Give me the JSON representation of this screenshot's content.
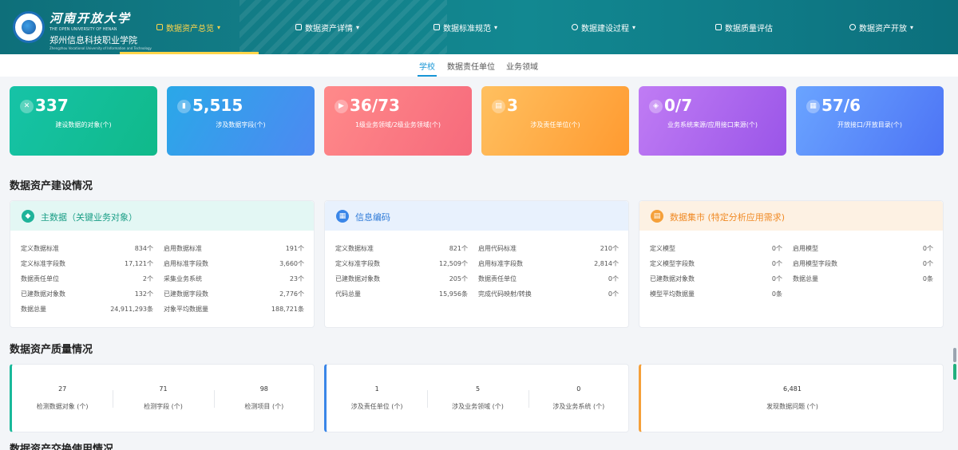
{
  "header": {
    "brand_cn": "河南开放大学",
    "brand_en": "THE OPEN UNIVERSITY OF HENAN",
    "brand_cn2": "郑州信息科技职业学院",
    "brand_en2": "Zhengzhou Vocational University of Information and Technology",
    "nav": [
      {
        "label": "数据资产总览",
        "caret": "▾"
      },
      {
        "label": "数据资产详情",
        "caret": "▾"
      },
      {
        "label": "数据标准规范",
        "caret": "▾"
      },
      {
        "label": "数据建设过程",
        "caret": "▾"
      },
      {
        "label": "数据质量评估",
        "caret": ""
      },
      {
        "label": "数据资产开放",
        "caret": "▾"
      }
    ]
  },
  "subtabs": [
    "学校",
    "数据责任单位",
    "业务领域"
  ],
  "stats": [
    {
      "value": "337",
      "label": "建设数据的对象(个)",
      "icon": "wrench-icon",
      "glyph": "✕",
      "color_from": "#16c3a7",
      "color_to": "#10b98a"
    },
    {
      "value": "5,515",
      "label": "涉及数据字段(个)",
      "icon": "bar-chart-icon",
      "glyph": "▮",
      "color_from": "#2aa8e8",
      "color_to": "#4d89f2"
    },
    {
      "value": "36/73",
      "label": "1级业务领域/2级业务领域(个)",
      "icon": "play-icon",
      "glyph": "▶",
      "color_from": "#ff8a8a",
      "color_to": "#f66a7c"
    },
    {
      "value": "3",
      "label": "涉及责任单位(个)",
      "icon": "document-icon",
      "glyph": "▤",
      "color_from": "#ffc060",
      "color_to": "#ff9a30"
    },
    {
      "value": "0/7",
      "label": "业务系统来源/应用接口来源(个)",
      "icon": "settings-icon",
      "glyph": "◈",
      "color_from": "#c07cf4",
      "color_to": "#9a55e8"
    },
    {
      "value": "57/6",
      "label": "开放接口/开放目录(个)",
      "icon": "grid-icon",
      "glyph": "▦",
      "color_from": "#6aa4ff",
      "color_to": "#4d74f5"
    }
  ],
  "sections": {
    "build": "数据资产建设情况",
    "quality": "数据资产质量情况",
    "next": "数据资产交换使用情况"
  },
  "panels": [
    {
      "title": "主数据（关键业务对象）",
      "icon": "cube-icon",
      "glyph": "◆",
      "head_bg": "#e3f7f4",
      "title_color": "#1a9e86",
      "icon_bg": "#1fb39a",
      "rows": [
        {
          "k1": "定义数据标准",
          "v1": "834个",
          "k2": "启用数据标准",
          "v2": "191个"
        },
        {
          "k1": "定义标准字段数",
          "v1": "17,121个",
          "k2": "启用标准字段数",
          "v2": "3,660个"
        },
        {
          "k1": "数据责任单位",
          "v1": "2个",
          "k2": "采集业务系统",
          "v2": "23个"
        },
        {
          "k1": "已建数据对象数",
          "v1": "132个",
          "k2": "已建数据字段数",
          "v2": "2,776个"
        },
        {
          "k1": "数据总量",
          "v1": "24,911,293条",
          "k2": "对象平均数据量",
          "v2": "188,721条"
        }
      ]
    },
    {
      "title": "信息编码",
      "icon": "calendar-icon",
      "glyph": "▦",
      "head_bg": "#e8f1fd",
      "title_color": "#2f7bd8",
      "icon_bg": "#3a86e8",
      "rows": [
        {
          "k1": "定义数据标准",
          "v1": "821个",
          "k2": "启用代码标准",
          "v2": "210个"
        },
        {
          "k1": "定义标准字段数",
          "v1": "12,509个",
          "k2": "启用标准字段数",
          "v2": "2,814个"
        },
        {
          "k1": "已建数据对象数",
          "v1": "205个",
          "k2": "数据责任单位",
          "v2": "0个"
        },
        {
          "k1": "代码总量",
          "v1": "15,956条",
          "k2": "完成代码映射/转换",
          "v2": "0个"
        }
      ]
    },
    {
      "title": "数据集市 (特定分析应用需求)",
      "icon": "database-icon",
      "glyph": "▤",
      "head_bg": "#fdf1e3",
      "title_color": "#f08a25",
      "icon_bg": "#f5a03a",
      "rows": [
        {
          "k1": "定义模型",
          "v1": "0个",
          "k2": "启用模型",
          "v2": "0个"
        },
        {
          "k1": "定义模型字段数",
          "v1": "0个",
          "k2": "启用模型字段数",
          "v2": "0个"
        },
        {
          "k1": "已建数据对象数",
          "v1": "0个",
          "k2": "数据总量",
          "v2": "0条"
        },
        {
          "k1": "模型平均数据量",
          "v1": "0条",
          "k2": "",
          "v2": ""
        }
      ]
    }
  ],
  "quality_panels": [
    {
      "accent": "#19b99a",
      "items": [
        {
          "value": "27",
          "label": "检测数据对象 (个)"
        },
        {
          "value": "71",
          "label": "检测字段 (个)"
        },
        {
          "value": "98",
          "label": "检测项目 (个)"
        }
      ]
    },
    {
      "accent": "#3a86e8",
      "items": [
        {
          "value": "1",
          "label": "涉及责任单位 (个)"
        },
        {
          "value": "5",
          "label": "涉及业务领域 (个)"
        },
        {
          "value": "0",
          "label": "涉及业务系统 (个)"
        }
      ]
    },
    {
      "accent": "#f5a03a",
      "items": [
        {
          "value": "6,481",
          "label": "发现数据问题 (个)"
        }
      ]
    }
  ]
}
